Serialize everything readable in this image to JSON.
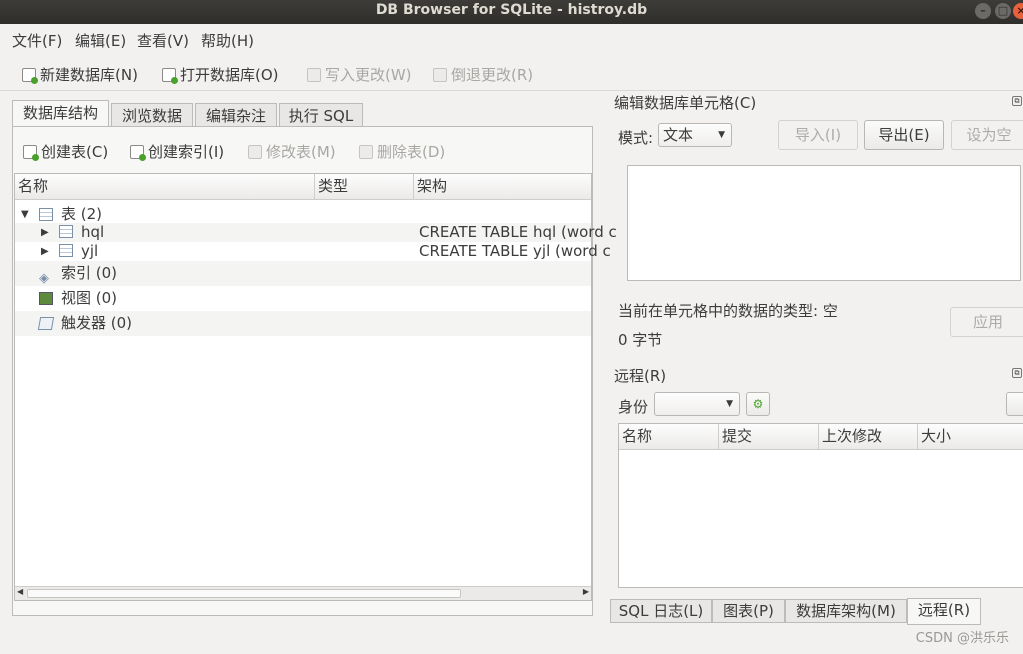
{
  "window": {
    "title": "DB Browser for SQLite - histroy.db",
    "min": "–",
    "max": "□",
    "close": "×"
  },
  "menu": [
    "文件(F)",
    "编辑(E)",
    "查看(V)",
    "帮助(H)"
  ],
  "toolbar": {
    "new_db": "新建数据库(N)",
    "open_db": "打开数据库(O)",
    "write_changes": "写入更改(W)",
    "revert_changes": "倒退更改(R)"
  },
  "tabs": [
    "数据库结构",
    "浏览数据",
    "编辑杂注",
    "执行 SQL"
  ],
  "structure_toolbar": {
    "create_table": "创建表(C)",
    "create_index": "创建索引(I)",
    "modify_table": "修改表(M)",
    "delete_table": "删除表(D)"
  },
  "tree": {
    "columns": [
      "名称",
      "类型",
      "架构"
    ],
    "rows": [
      {
        "name": "表 (2)",
        "type": "",
        "schema": ""
      },
      {
        "name": "hql",
        "type": "",
        "schema": "CREATE TABLE hql (word c"
      },
      {
        "name": "yjl",
        "type": "",
        "schema": "CREATE TABLE yjl (word c"
      },
      {
        "name": "索引 (0)",
        "type": "",
        "schema": ""
      },
      {
        "name": "视图 (0)",
        "type": "",
        "schema": ""
      },
      {
        "name": "触发器 (0)",
        "type": "",
        "schema": ""
      }
    ]
  },
  "edit_cell": {
    "title": "编辑数据库单元格(C)",
    "mode_label": "模式:",
    "mode_value": "文本",
    "import": "导入(I)",
    "export": "导出(E)",
    "set_null": "设为空",
    "type_info": "当前在单元格中的数据的类型: 空",
    "size_info": "0 字节",
    "apply": "应用"
  },
  "remote": {
    "title": "远程(R)",
    "identity_label": "身份",
    "identity_value": "",
    "columns": [
      "名称",
      "提交",
      "上次修改",
      "大小"
    ]
  },
  "bottom_tabs": [
    "SQL 日志(L)",
    "图表(P)",
    "数据库架构(M)",
    "远程(R)"
  ],
  "watermark": "CSDN @洪乐乐"
}
